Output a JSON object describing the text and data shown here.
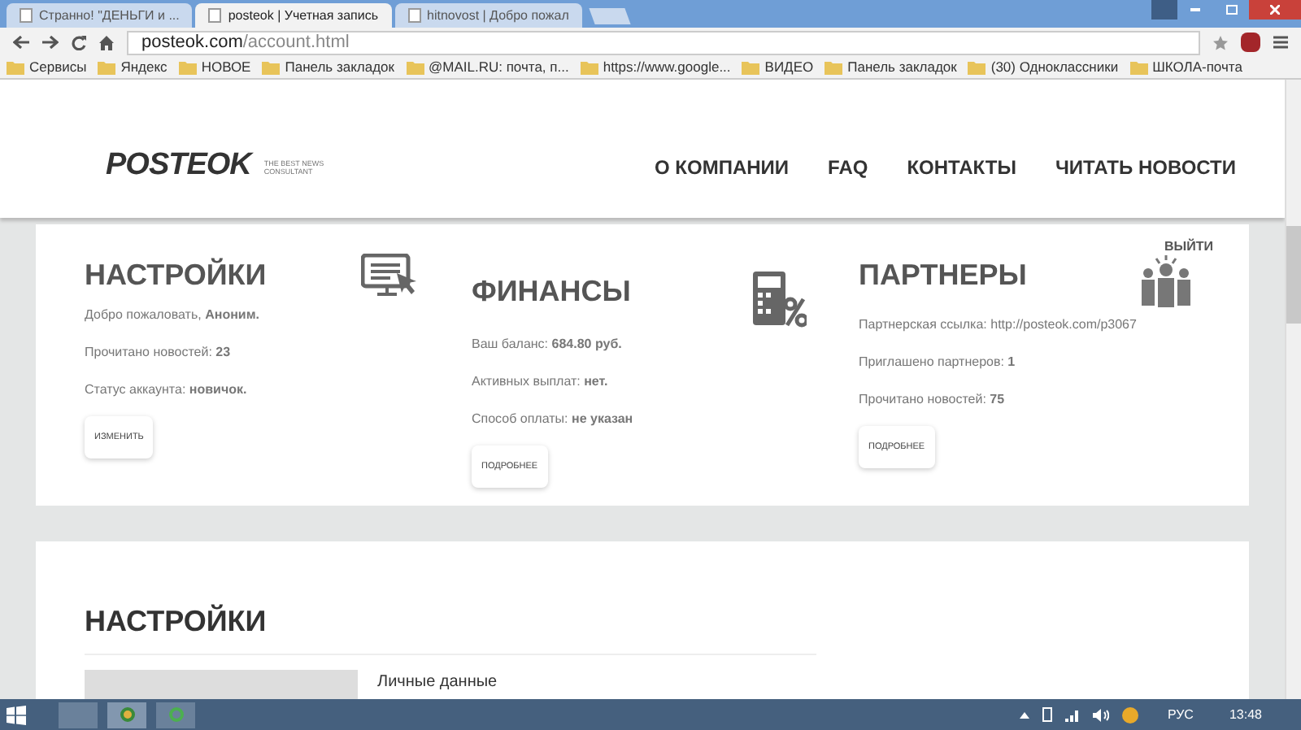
{
  "browser": {
    "tabs": [
      {
        "title": "Странно! \"ДЕНЬГИ и ...",
        "selected": false
      },
      {
        "title": "posteok | Учетная запись",
        "selected": true
      },
      {
        "title": "hitnovost | Добро пожал",
        "selected": false
      }
    ],
    "url_host": "posteok.com",
    "url_path": "/account.html",
    "bookmarks": [
      "Сервисы",
      "Яндекс",
      "НОВОЕ",
      "Панель закладок",
      "@MAIL.RU: почта, п...",
      "https://www.google...",
      "ВИДЕО",
      "Панель закладок",
      "(30) Одноклассники",
      "ШКОЛА-почта"
    ]
  },
  "header": {
    "logo": "POSTEOK",
    "tagline": "THE BEST NEWS CONSULTANT",
    "nav": [
      "О КОМПАНИИ",
      "FAQ",
      "КОНТАКТЫ",
      "ЧИТАТЬ НОВОСТИ"
    ]
  },
  "logout": "ВЫЙТИ",
  "panels": [
    {
      "title": "НАСТРОЙКИ",
      "lines": [
        "Добро пожаловать, **Аноним.**",
        "Прочитано новостей: **23**",
        "Статус аккаунта: **новичок.**"
      ],
      "button": "ИЗМЕНИТЬ"
    },
    {
      "title": "ФИНАНСЫ",
      "lines": [
        "Ваш баланс: **684.80 руб.**",
        "Активных выплат: **нет.**",
        "Способ оплаты: **не указан**"
      ],
      "button": "ПОДРОБНЕЕ"
    },
    {
      "title": "ПАРТНЕРЫ",
      "lines": [
        "Партнерская ссылка: http://posteok.com/p3067",
        "Приглашено партнеров: **1**",
        "Прочитано новостей: **75**"
      ],
      "button": "ПОДРОБНЕЕ"
    }
  ],
  "settings": {
    "title": "НАСТРОЙКИ",
    "section_label": "Личные данные"
  },
  "taskbar": {
    "language": "РУС",
    "time": "13:48"
  }
}
